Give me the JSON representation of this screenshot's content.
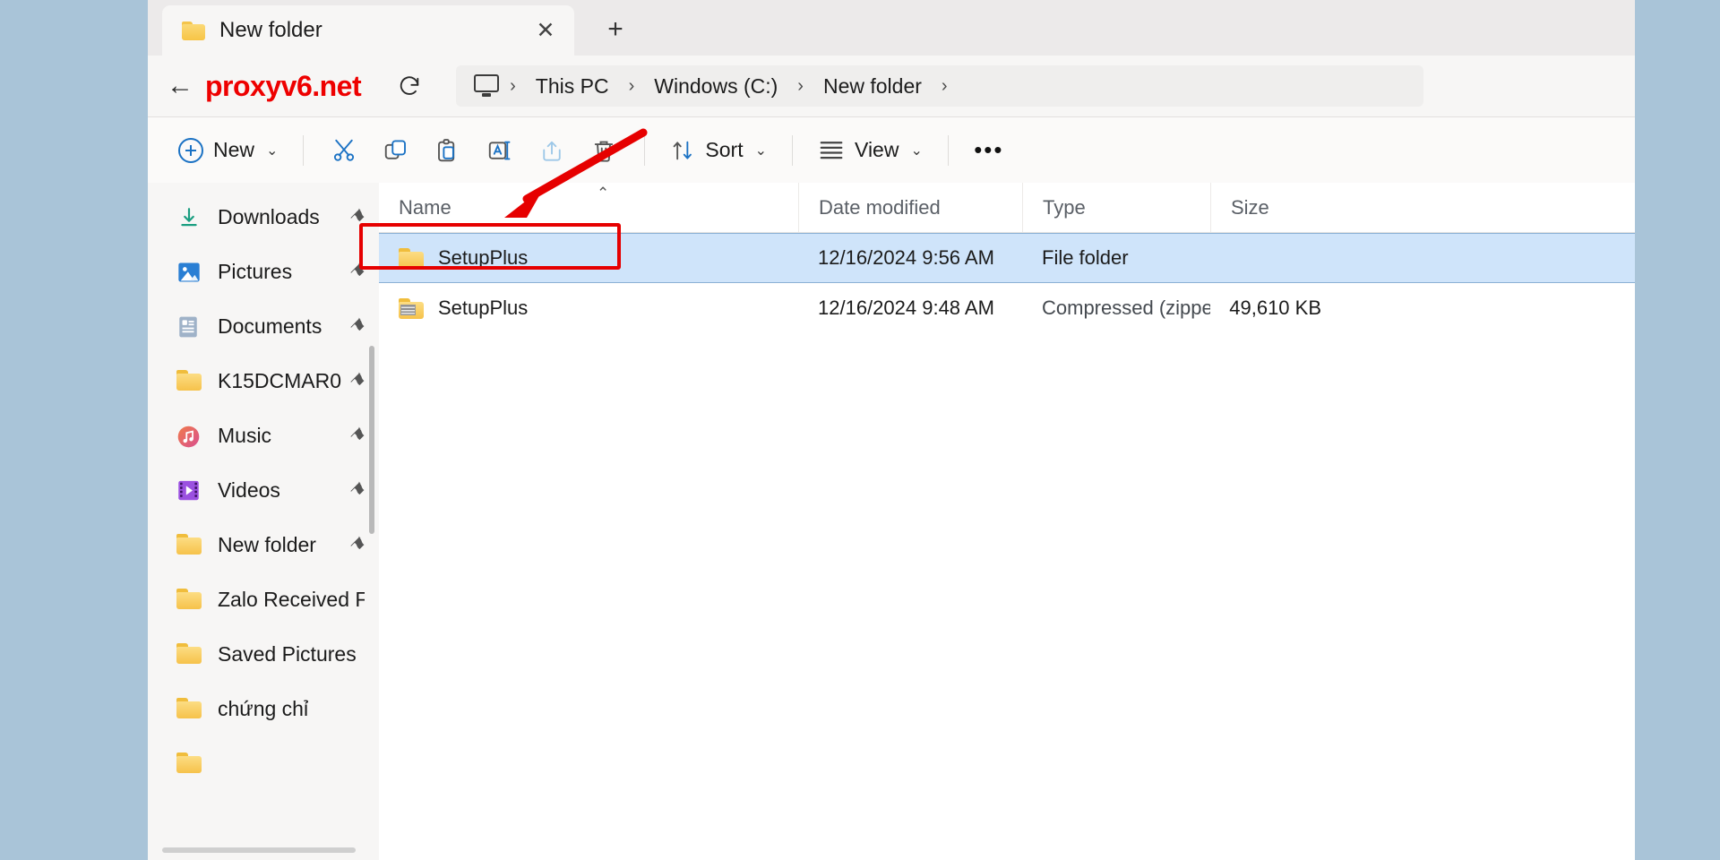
{
  "window": {
    "tab": {
      "title": "New folder",
      "icon": "folder-icon",
      "close_label": "✕",
      "newtab_label": "+"
    }
  },
  "nav": {
    "back_label": "←",
    "watermark": "proxyv6.net",
    "refresh_label": "↻",
    "breadcrumb": {
      "root_icon": "this-pc-icon",
      "separator": "›",
      "items": [
        "This PC",
        "Windows (C:)",
        "New folder"
      ]
    }
  },
  "toolbar": {
    "new_label": "New",
    "chevron": "⌄",
    "items": [
      {
        "name": "cut",
        "label": "Cut"
      },
      {
        "name": "copy",
        "label": "Copy"
      },
      {
        "name": "paste",
        "label": "Paste"
      },
      {
        "name": "rename",
        "label": "Rename"
      },
      {
        "name": "share",
        "label": "Share"
      },
      {
        "name": "delete",
        "label": "Delete"
      }
    ],
    "sort_label": "Sort",
    "view_label": "View",
    "more_label": "•••"
  },
  "sidebar": {
    "pin_glyph": "⚑",
    "items": [
      {
        "label": "Downloads",
        "icon": "downloads-icon",
        "pinned": true
      },
      {
        "label": "Pictures",
        "icon": "pictures-icon",
        "pinned": true
      },
      {
        "label": "Documents",
        "icon": "documents-icon",
        "pinned": true
      },
      {
        "label": "K15DCMAR0",
        "icon": "folder-icon",
        "pinned": true
      },
      {
        "label": "Music",
        "icon": "music-icon",
        "pinned": true
      },
      {
        "label": "Videos",
        "icon": "videos-icon",
        "pinned": true
      },
      {
        "label": "New folder",
        "icon": "folder-icon",
        "pinned": true
      },
      {
        "label": "Zalo Received Fil",
        "icon": "folder-icon",
        "pinned": false
      },
      {
        "label": "Saved Pictures",
        "icon": "folder-icon",
        "pinned": false
      },
      {
        "label": "chứng chỉ",
        "icon": "folder-icon",
        "pinned": false
      },
      {
        "label": "",
        "icon": "folder-icon",
        "pinned": false
      }
    ]
  },
  "filelist": {
    "columns": [
      "Name",
      "Date modified",
      "Type",
      "Size"
    ],
    "sort_caret": "⌃",
    "rows": [
      {
        "name": "SetupPlus",
        "icon": "folder-icon",
        "date_modified": "12/16/2024 9:56 AM",
        "type": "File folder",
        "size": "",
        "selected": true
      },
      {
        "name": "SetupPlus",
        "icon": "zip-folder-icon",
        "date_modified": "12/16/2024 9:48 AM",
        "type": "Compressed (zipped)...",
        "size": "49,610 KB",
        "selected": false
      }
    ]
  },
  "annotation": {
    "highlight_color": "#e60000",
    "arrow_color": "#e60000"
  }
}
